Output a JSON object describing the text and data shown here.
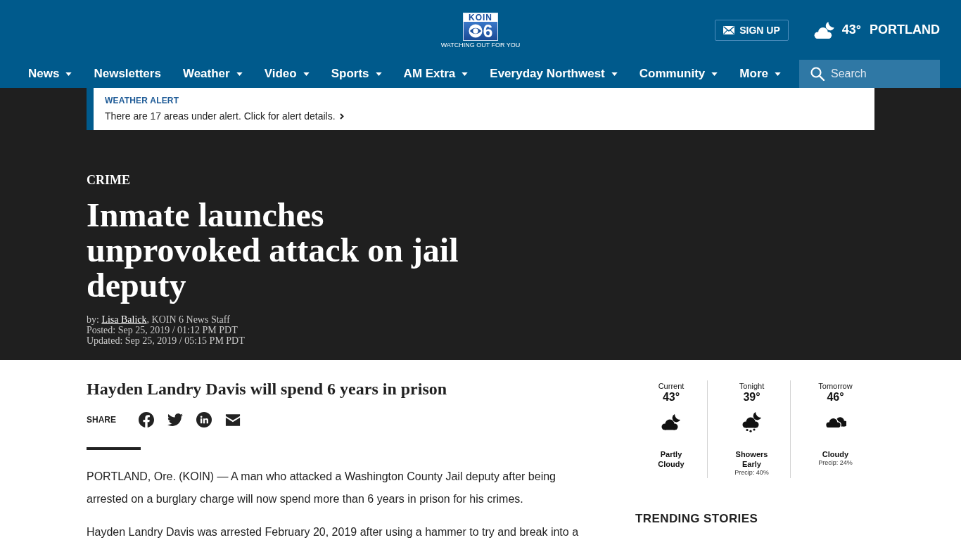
{
  "header": {
    "logo": {
      "wordmark": "KOIN",
      "numeral": "6",
      "tagline": "WATCHING OUT FOR YOU"
    },
    "signup_button": "SIGN UP",
    "weather": {
      "kind": "partly-cloudy-night",
      "temp": "43°",
      "city": "PORTLAND"
    }
  },
  "nav": {
    "items": [
      {
        "label": "News",
        "dropdown": true
      },
      {
        "label": "Newsletters",
        "dropdown": false
      },
      {
        "label": "Weather",
        "dropdown": true
      },
      {
        "label": "Video",
        "dropdown": true
      },
      {
        "label": "Sports",
        "dropdown": true
      },
      {
        "label": "AM Extra",
        "dropdown": true
      },
      {
        "label": "Everyday Northwest",
        "dropdown": true
      },
      {
        "label": "Community",
        "dropdown": true
      },
      {
        "label": "More",
        "dropdown": true
      }
    ],
    "search": {
      "placeholder": "Search"
    }
  },
  "alert": {
    "title": "WEATHER ALERT",
    "text": "There are 17 areas under alert. Click for alert details."
  },
  "article": {
    "category": "CRIME",
    "headline": "Inmate launches unprovoked attack on jail deputy",
    "byline": {
      "prefix": "by:",
      "author": "Lisa Balick",
      "suffix": ", KOIN 6 News Staff",
      "posted": "Posted: Sep 25, 2019 / 01:12 PM PDT",
      "updated": "Updated: Sep 25, 2019 / 05:15 PM PDT"
    },
    "subheadline": "Hayden Landry Davis will spend 6 years in prison",
    "share": {
      "label": "SHARE",
      "icons": [
        {
          "kind": "facebook"
        },
        {
          "kind": "twitter"
        },
        {
          "kind": "linkedin"
        },
        {
          "kind": "email"
        }
      ]
    },
    "paragraphs": [
      "PORTLAND, Ore. (KOIN) — A man who attacked a Washington County Jail deputy after being arrested on a burglary charge will now spend more than 6 years in prison for his crimes.",
      "Hayden Landry Davis was arrested February 20, 2019 after using a hammer to try and break into a"
    ]
  },
  "sidebar": {
    "forecast": [
      {
        "label": "Current",
        "temp": "43°",
        "kind": "partly-cloudy-night",
        "condition": "Partly Cloudy"
      },
      {
        "label": "Tonight",
        "temp": "39°",
        "kind": "showers-night",
        "condition": "Showers Early",
        "precip": "Precip: 40%"
      },
      {
        "label": "Tomorrow",
        "temp": "46°",
        "kind": "cloudy",
        "condition": "Cloudy",
        "precip": "Precip: 24%"
      }
    ],
    "trending_title": "TRENDING STORIES"
  }
}
